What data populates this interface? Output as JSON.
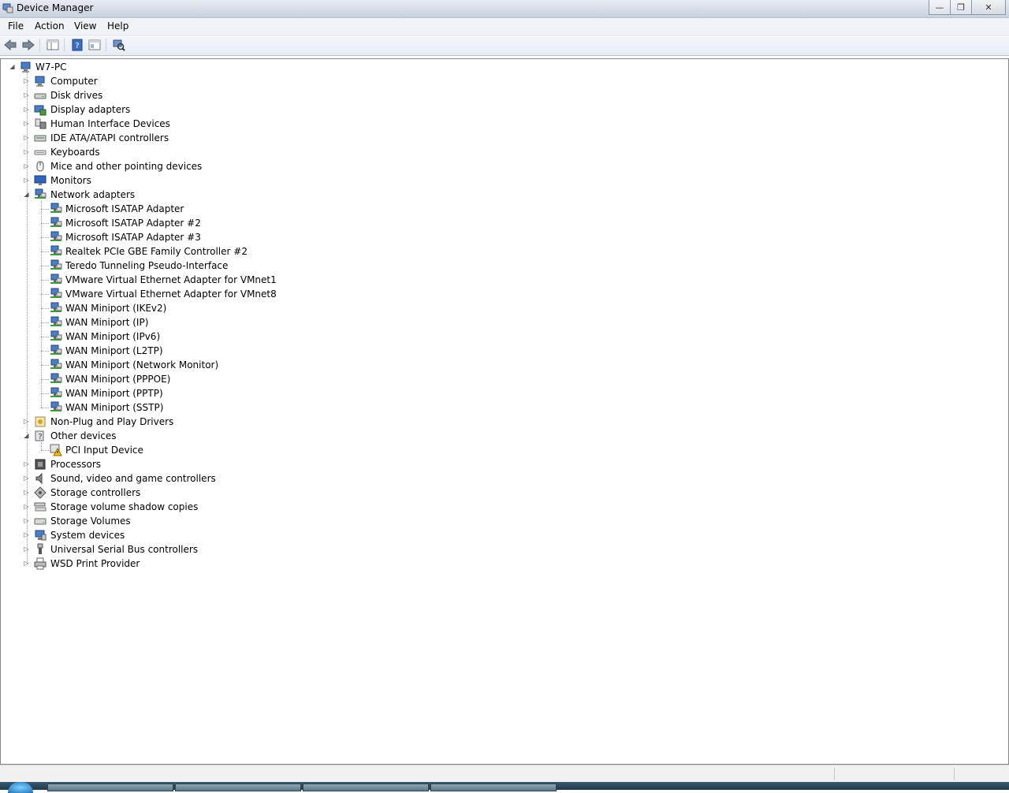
{
  "window": {
    "title": "Device Manager"
  },
  "menu": [
    "File",
    "Action",
    "View",
    "Help"
  ],
  "toolbar": [
    "back-icon",
    "forward-icon",
    "properties-pane-icon",
    "help-icon",
    "console-tree-icon",
    "scan-hardware-icon"
  ],
  "tree": {
    "root": {
      "label": "W7-PC",
      "icon": "computer-icon"
    },
    "categories": [
      {
        "label": "Computer",
        "icon": "computer-icon",
        "expanded": false
      },
      {
        "label": "Disk drives",
        "icon": "disk-drive-icon",
        "expanded": false
      },
      {
        "label": "Display adapters",
        "icon": "display-adapter-icon",
        "expanded": false
      },
      {
        "label": "Human Interface Devices",
        "icon": "hid-icon",
        "expanded": false
      },
      {
        "label": "IDE ATA/ATAPI controllers",
        "icon": "ide-controller-icon",
        "expanded": false
      },
      {
        "label": "Keyboards",
        "icon": "keyboard-icon",
        "expanded": false
      },
      {
        "label": "Mice and other pointing devices",
        "icon": "mouse-icon",
        "expanded": false
      },
      {
        "label": "Monitors",
        "icon": "monitor-icon",
        "expanded": false
      },
      {
        "label": "Network adapters",
        "icon": "network-adapter-icon",
        "expanded": true,
        "children": [
          "Microsoft ISATAP Adapter",
          "Microsoft ISATAP Adapter #2",
          "Microsoft ISATAP Adapter #3",
          "Realtek PCIe GBE Family Controller #2",
          "Teredo Tunneling Pseudo-Interface",
          "VMware Virtual Ethernet Adapter for VMnet1",
          "VMware Virtual Ethernet Adapter for VMnet8",
          "WAN Miniport (IKEv2)",
          "WAN Miniport (IP)",
          "WAN Miniport (IPv6)",
          "WAN Miniport (L2TP)",
          "WAN Miniport (Network Monitor)",
          "WAN Miniport (PPPOE)",
          "WAN Miniport (PPTP)",
          "WAN Miniport (SSTP)"
        ],
        "child_icon": "network-adapter-icon"
      },
      {
        "label": "Non-Plug and Play Drivers",
        "icon": "driver-icon",
        "expanded": false
      },
      {
        "label": "Other devices",
        "icon": "unknown-device-icon",
        "expanded": true,
        "children": [
          "PCI Input Device"
        ],
        "child_icon": "warning-device-icon"
      },
      {
        "label": "Processors",
        "icon": "processor-icon",
        "expanded": false
      },
      {
        "label": "Sound, video and game controllers",
        "icon": "speaker-icon",
        "expanded": false
      },
      {
        "label": "Storage controllers",
        "icon": "storage-controller-icon",
        "expanded": false
      },
      {
        "label": "Storage volume shadow copies",
        "icon": "shadow-copy-icon",
        "expanded": false
      },
      {
        "label": "Storage Volumes",
        "icon": "storage-volume-icon",
        "expanded": false
      },
      {
        "label": "System devices",
        "icon": "system-device-icon",
        "expanded": false
      },
      {
        "label": "Universal Serial Bus controllers",
        "icon": "usb-icon",
        "expanded": false
      },
      {
        "label": "WSD Print Provider",
        "icon": "printer-icon",
        "expanded": false
      }
    ]
  }
}
